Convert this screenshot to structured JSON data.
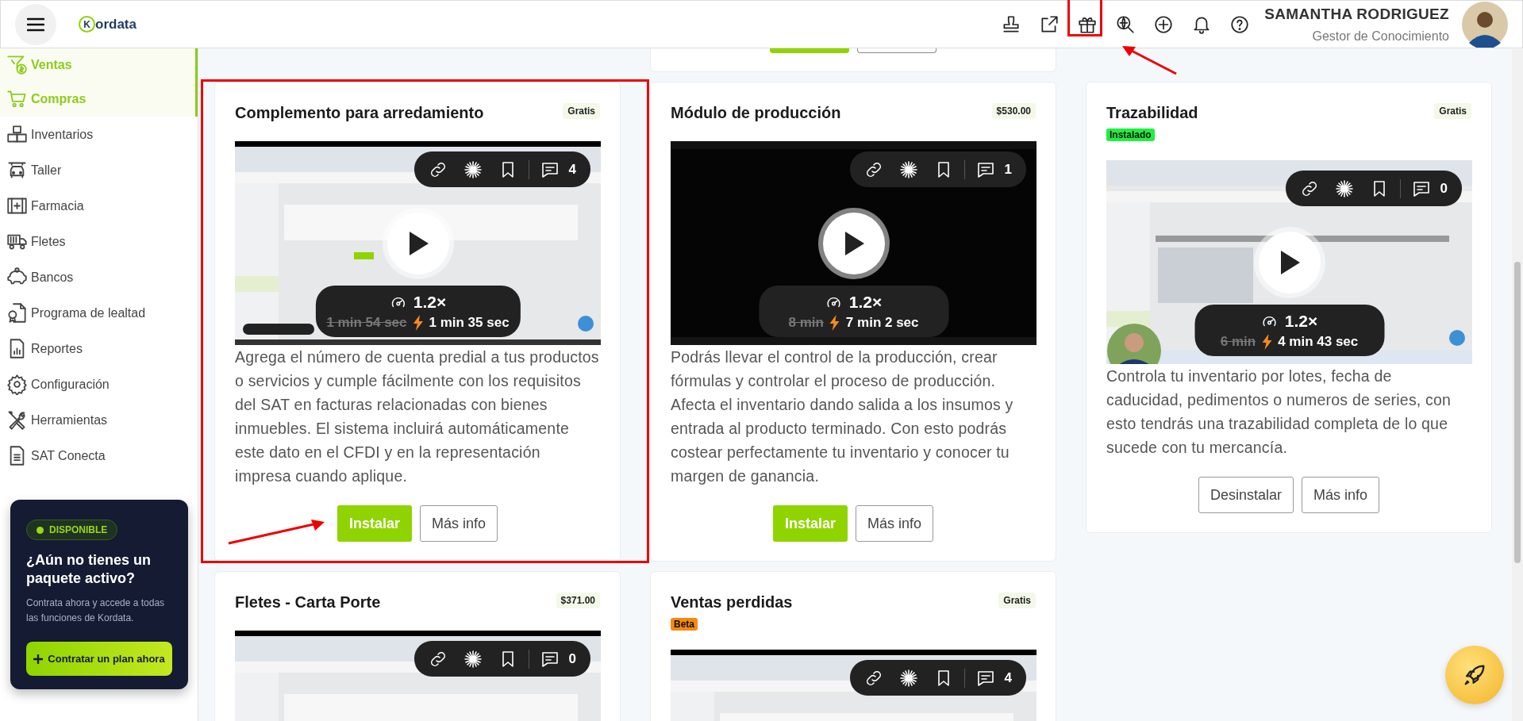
{
  "header": {
    "logo": {
      "initial": "K",
      "text": "ordata"
    },
    "user_name": "SAMANTHA RODRIGUEZ",
    "user_role": "Gestor de Conocimiento",
    "gift_highlighted": true
  },
  "sidebar": {
    "items": [
      {
        "label": "Ventas",
        "selected": true
      },
      {
        "label": "Compras",
        "selected": true
      },
      {
        "label": "Inventarios",
        "selected": false
      },
      {
        "label": "Taller",
        "selected": false
      },
      {
        "label": "Farmacia",
        "selected": false
      },
      {
        "label": "Fletes",
        "selected": false
      },
      {
        "label": "Bancos",
        "selected": false
      },
      {
        "label": "Programa de lealtad",
        "selected": false
      },
      {
        "label": "Reportes",
        "selected": false
      },
      {
        "label": "Configuración",
        "selected": false
      },
      {
        "label": "Herramientas",
        "selected": false
      },
      {
        "label": "SAT Conecta",
        "selected": false
      }
    ],
    "promo": {
      "badge": "DISPONIBLE",
      "title": "¿Aún no tienes un paquete activo?",
      "text": "Contrata ahora y accede a todas las funciones de Kordata.",
      "button": "Contratar un plan ahora"
    }
  },
  "partial_card": {
    "buttons": [
      {
        "kind": "install"
      },
      {
        "kind": "info"
      }
    ]
  },
  "card_rows": [
    [
      {
        "title": "Complemento para arredamiento",
        "price": "Gratis",
        "highlighted": true,
        "video": {
          "comments": "4",
          "speed": "1.2×",
          "original_time": "1 min 54 sec",
          "new_time": "1 min 35 sec"
        },
        "description": "Agrega el número de cuenta predial a tus productos o servicios y cumple fácilmente con los requisitos del SAT en facturas relacionadas con bienes inmuebles. El sistema incluirá automáticamente este dato en el CFDI y en la representación impresa cuando aplique.",
        "buttons": [
          {
            "label": "Instalar",
            "kind": "install"
          },
          {
            "label": "Más info",
            "kind": "info"
          }
        ]
      },
      {
        "title": "Módulo de producción",
        "price": "$530.00",
        "highlighted": false,
        "video": {
          "comments": "1",
          "speed": "1.2×",
          "original_time": "8 min",
          "new_time": "7 min 2 sec"
        },
        "description": "Podrás llevar el control de la producción, crear fórmulas y controlar el proceso de producción. Afecta el inventario dando salida a los insumos y entrada al producto terminado. Con esto podrás costear perfectamente tu inventario y conocer tu margen de ganancia.",
        "buttons": [
          {
            "label": "Instalar",
            "kind": "install"
          },
          {
            "label": "Más info",
            "kind": "info"
          }
        ]
      },
      {
        "title": "Trazabilidad",
        "price": "Gratis",
        "status": {
          "label": "Instalado",
          "kind": "installed"
        },
        "highlighted": false,
        "video": {
          "comments": "0",
          "speed": "1.2×",
          "original_time": "6 min",
          "new_time": "4 min 43 sec"
        },
        "description": "Controla tu inventario por lotes, fecha de caducidad, pedimentos o numeros de series, con esto tendrás una trazabilidad completa de lo que sucede con tu mercancía.",
        "buttons": [
          {
            "label": "Desinstalar",
            "kind": "uninstall"
          },
          {
            "label": "Más info",
            "kind": "info"
          }
        ]
      }
    ],
    [
      {
        "title": "Fletes - Carta Porte",
        "price": "$371.00",
        "highlighted": false,
        "video": {
          "comments": "0"
        }
      },
      {
        "title": "Ventas perdidas",
        "price": "Gratis",
        "status": {
          "label": "Beta",
          "kind": "beta"
        },
        "highlighted": false,
        "video": {
          "comments": "4"
        }
      }
    ]
  ]
}
